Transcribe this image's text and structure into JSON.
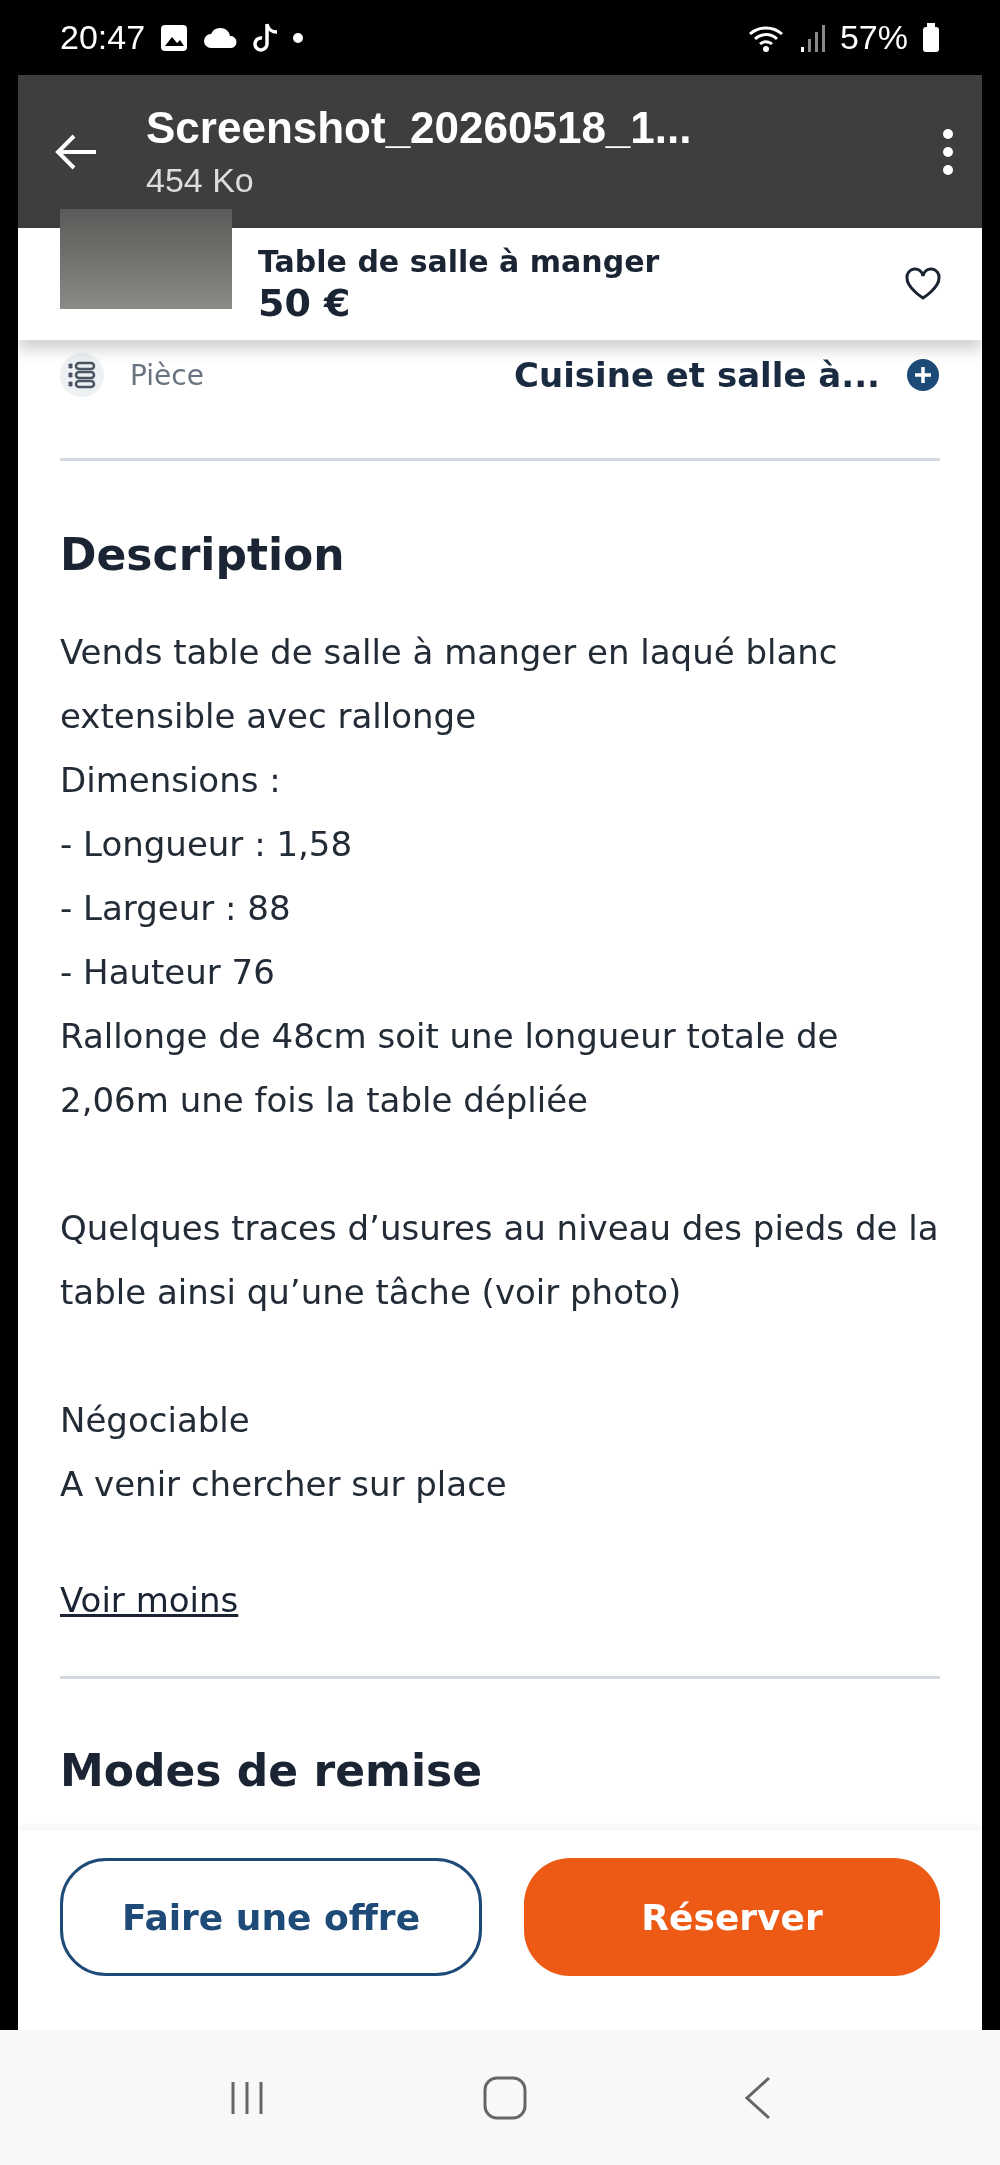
{
  "status_bar": {
    "time": "20:47",
    "battery": "57%"
  },
  "viewer": {
    "title": "Screenshot_20260518_1...",
    "subtitle": "454 Ko"
  },
  "listing": {
    "title": "Table de salle à manger",
    "price": "50 €",
    "favorite": false
  },
  "attribute": {
    "label": "Pièce",
    "value": "Cuisine et salle à..."
  },
  "description": {
    "heading": "Description",
    "paragraphs": [
      [
        "Vends table de salle à manger en laqué blanc extensible avec rallonge",
        "Dimensions :",
        "- Longueur : 1,58",
        "- Largeur : 88",
        "- Hauteur 76",
        "Rallonge de 48cm soit une longueur totale de 2,06m une fois la table dépliée"
      ],
      [
        "Quelques traces d’usures au niveau des pieds de la table ainsi qu’une tâche (voir photo)"
      ],
      [
        "Négociable",
        "A venir chercher sur place"
      ]
    ],
    "toggle": "Voir moins"
  },
  "next_section": "Modes de remise",
  "actions": [
    {
      "label": "Faire une offre",
      "kind": "outline"
    },
    {
      "label": "Réserver",
      "kind": "primary"
    }
  ]
}
